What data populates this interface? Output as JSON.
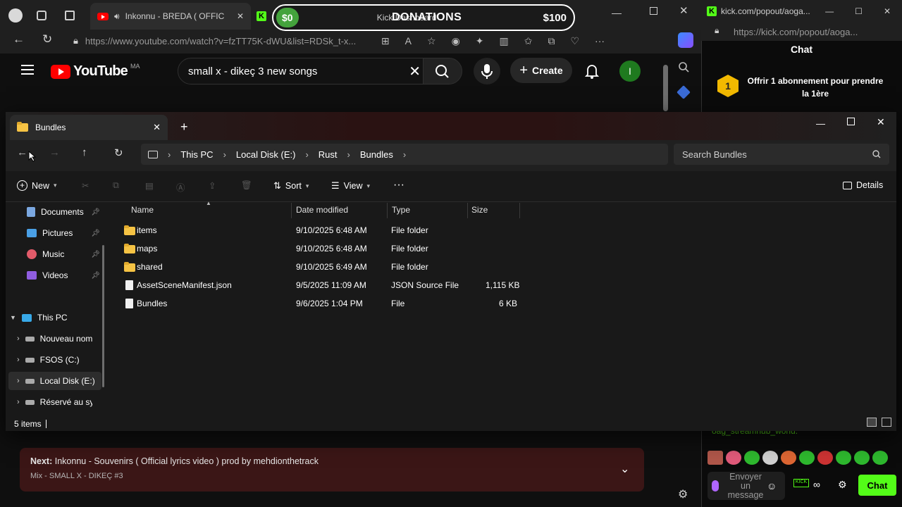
{
  "browser": {
    "tab_yt_title": "Inkonnu - BREDA ( OFFICIA",
    "tab_kick_title": "Kick Dashboard",
    "address": "https://www.youtube.com/watch?v=fzTT75K-dWU&list=RDSk_t-x..."
  },
  "donations": {
    "left_amount": "$0",
    "title": "DONATIONS",
    "right_amount": "$100"
  },
  "youtube": {
    "wordmark": "YouTube",
    "country": "MA",
    "search_value": "small x - dikeç 3 new songs",
    "create_label": "Create",
    "avatar_letter": "I",
    "next_label": "Next:",
    "next_title": "Inkonnu - Souvenirs ( Official lyrics video ) prod by mehdionthetrack",
    "next_sub": "Mix - SMALL X - DIKEÇ #3"
  },
  "kick": {
    "address": "https://kick.com/popout/aoga...",
    "tab_title": "kick.com/popout/aoga...",
    "chat_title": "Chat",
    "sub_badge": "1",
    "sub_text": "Offrir 1 abonnement pour prendre la 1ère",
    "chat_user": "oag_streamhub_world:",
    "input_placeholder": "Envoyer un message",
    "chat_button": "Chat"
  },
  "explorer": {
    "tab_title": "Bundles",
    "breadcrumb": [
      "This PC",
      "Local Disk (E:)",
      "Rust",
      "Bundles"
    ],
    "search_placeholder": "Search Bundles",
    "cmd": {
      "new": "New",
      "sort": "Sort",
      "view": "View",
      "details": "Details"
    },
    "columns": {
      "name": "Name",
      "date": "Date modified",
      "type": "Type",
      "size": "Size"
    },
    "nav_quick": [
      {
        "label": "Documents",
        "icon": "documents-icon"
      },
      {
        "label": "Pictures",
        "icon": "pictures-icon"
      },
      {
        "label": "Music",
        "icon": "music-icon"
      },
      {
        "label": "Videos",
        "icon": "videos-icon"
      }
    ],
    "nav_pc": "This PC",
    "nav_drives": [
      "Nouveau nom",
      "FSOS (C:)",
      "Local Disk (E:)",
      "Réservé au sys"
    ],
    "rows": [
      {
        "name": "items",
        "date": "9/10/2025 6:48 AM",
        "type": "File folder",
        "size": "",
        "kind": "folder"
      },
      {
        "name": "maps",
        "date": "9/10/2025 6:48 AM",
        "type": "File folder",
        "size": "",
        "kind": "folder"
      },
      {
        "name": "shared",
        "date": "9/10/2025 6:49 AM",
        "type": "File folder",
        "size": "",
        "kind": "folder"
      },
      {
        "name": "AssetSceneManifest.json",
        "date": "9/5/2025 11:09 AM",
        "type": "JSON Source File",
        "size": "1,115 KB",
        "kind": "file"
      },
      {
        "name": "Bundles",
        "date": "9/6/2025 1:04 PM",
        "type": "File",
        "size": "6 KB",
        "kind": "file"
      }
    ],
    "status": "5 items"
  }
}
